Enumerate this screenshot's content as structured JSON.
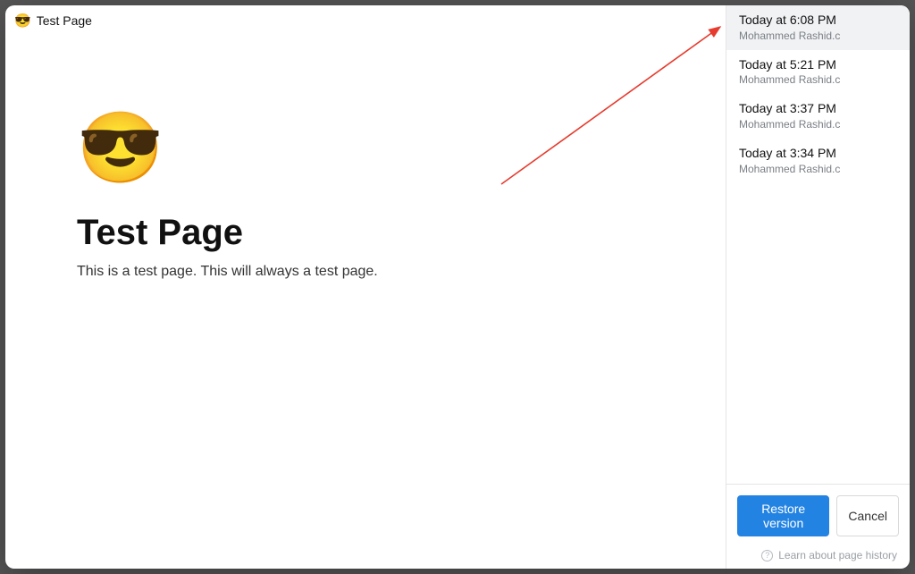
{
  "header": {
    "emoji": "😎",
    "title": "Test Page"
  },
  "page": {
    "icon": "😎",
    "title": "Test Page",
    "body": "This is a test page. This will always a test page."
  },
  "versions": [
    {
      "time": "Today at 6:08 PM",
      "author": "Mohammed Rashid.c",
      "selected": true
    },
    {
      "time": "Today at 5:21 PM",
      "author": "Mohammed Rashid.c",
      "selected": false
    },
    {
      "time": "Today at 3:37 PM",
      "author": "Mohammed Rashid.c",
      "selected": false
    },
    {
      "time": "Today at 3:34 PM",
      "author": "Mohammed Rashid.c",
      "selected": false
    }
  ],
  "footer": {
    "restore_label": "Restore version",
    "cancel_label": "Cancel",
    "help_text": "Learn about page history"
  }
}
